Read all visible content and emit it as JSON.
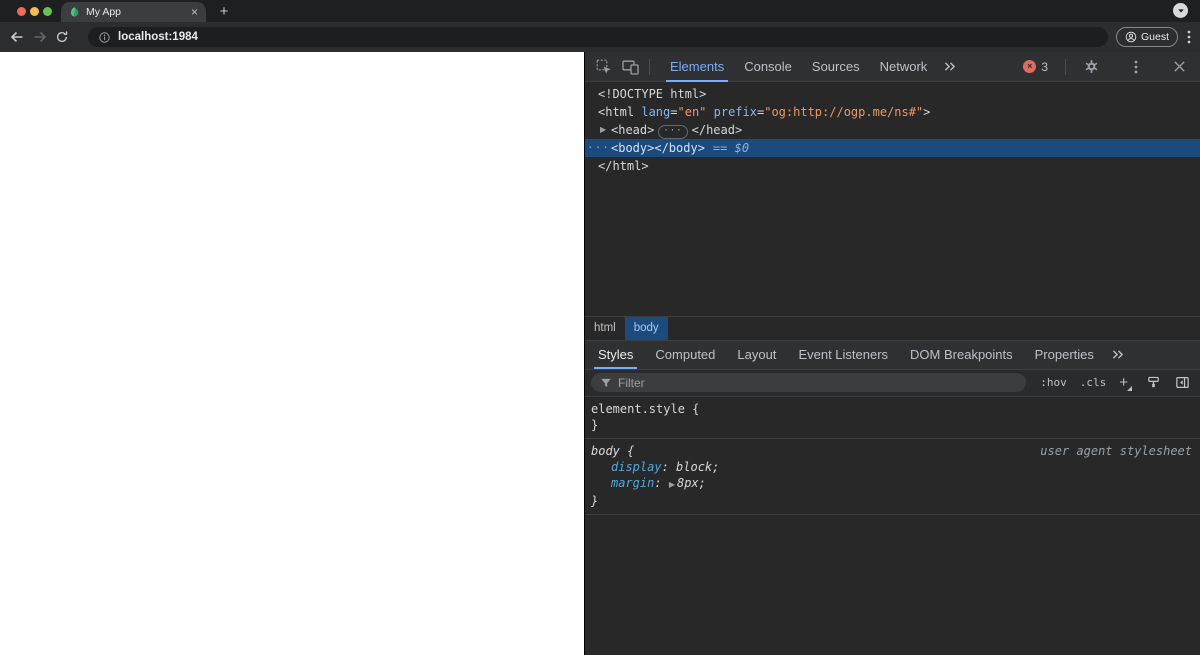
{
  "window": {
    "tab_title": "My App",
    "new_tab_label": "+",
    "url": "localhost:1984",
    "profile_label": "Guest"
  },
  "devtools": {
    "tabs": [
      "Elements",
      "Console",
      "Sources",
      "Network"
    ],
    "active_tab": "Elements",
    "error_count": "3",
    "dom_tree": {
      "doctype": "<!DOCTYPE html>",
      "html_open_tag": "<html ",
      "lang_attr": {
        "name": "lang",
        "eq": "=",
        "value": "\"en\""
      },
      "prefix_attr": {
        "name": " prefix",
        "eq": "=",
        "value": "\"og:http://ogp.me/ns#\""
      },
      "html_open_end": ">",
      "expander": "▶",
      "head_open": "<head>",
      "head_ellipsis": "···",
      "head_close": "</head>",
      "row_menu_dots": "···",
      "body_element": "<body></body>",
      "selected_flag": "== $0",
      "html_close": "</html>"
    },
    "breadcrumbs": [
      "html",
      "body"
    ],
    "panel_tabs": [
      "Styles",
      "Computed",
      "Layout",
      "Event Listeners",
      "DOM Breakpoints",
      "Properties"
    ],
    "active_panel_tab": "Styles",
    "filter": {
      "placeholder": "Filter",
      "pseudo_toggle": ":hov",
      "class_toggle": ".cls",
      "new_rule": "+"
    },
    "styles_pane": {
      "inline_rule": {
        "selector": "element.style",
        "brace_open": " {",
        "brace_close": "}"
      },
      "body_rule": {
        "selector": "body",
        "brace_open": " {",
        "brace_close": "}",
        "origin": "user agent stylesheet",
        "declarations": [
          {
            "property": "display",
            "colon": ": ",
            "value": "block;"
          },
          {
            "property": "margin",
            "colon": ": ",
            "expander": "▶",
            "value": "8px;"
          }
        ]
      }
    }
  },
  "colors": {
    "accent_blue": "#7cacf8",
    "selection_blue": "#1d4a7d",
    "attr_name_blue": "#85b7f3",
    "attr_value_orange": "#ee9866",
    "css_property_blue": "#53a6d8",
    "error_red": "#e46962",
    "favicon_green": "#48c78a"
  }
}
